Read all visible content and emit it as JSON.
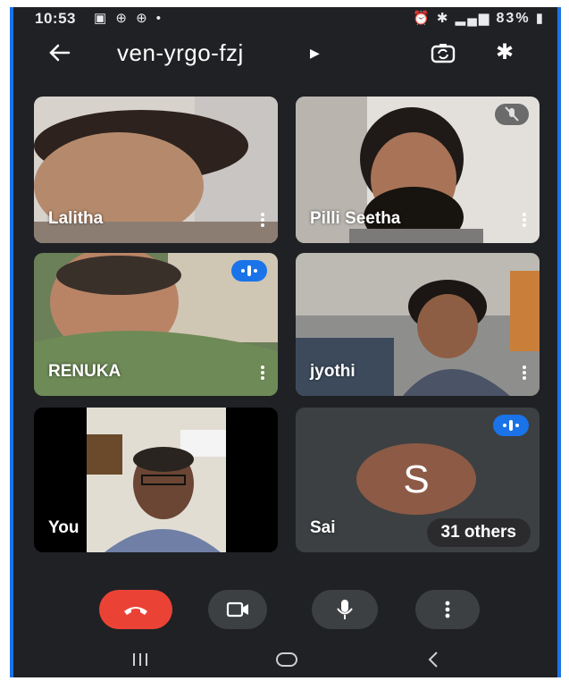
{
  "status_bar": {
    "time": "10:53",
    "battery": "83%"
  },
  "meeting": {
    "code": "ven-yrgo-fzj"
  },
  "participants": [
    {
      "name": "Lalitha"
    },
    {
      "name": "Pilli Seetha"
    },
    {
      "name": "RENUKA"
    },
    {
      "name": "jyothi"
    },
    {
      "name": "You"
    },
    {
      "name": "Sai",
      "avatar_letter": "S"
    }
  ],
  "others_label": "31 others",
  "colors": {
    "background": "#202124",
    "accent": "#1a73e8",
    "end_call": "#ea4335",
    "avatar": "#8d5a46"
  },
  "icons": {
    "back": "arrow-left-icon",
    "switch_camera": "switch-camera-icon",
    "bluetooth": "bluetooth-icon",
    "end_call": "phone-hangup-icon",
    "camera": "video-camera-icon",
    "mic": "microphone-icon",
    "more": "more-vertical-icon",
    "nav_recents": "recents-icon",
    "nav_home": "home-icon",
    "nav_back": "back-icon"
  }
}
